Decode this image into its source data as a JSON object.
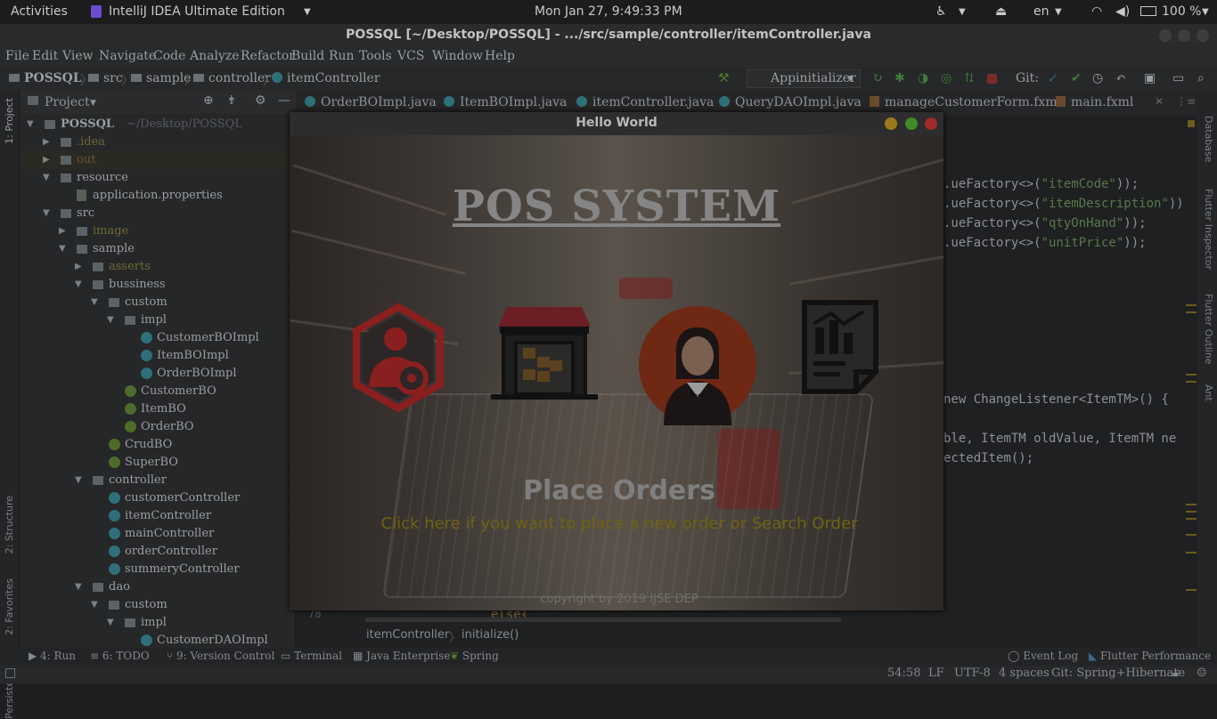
{
  "topbar": {
    "activities": "Activities",
    "app_name": "IntelliJ IDEA Ultimate Edition",
    "clock": "Mon Jan 27,  9:49:33 PM",
    "keyboard": "en",
    "battery": "100 %"
  },
  "ide": {
    "title": "POSSQL [~/Desktop/POSSQL] - .../src/sample/controller/itemController.java",
    "menu": [
      "File",
      "Edit",
      "View",
      "Navigate",
      "Code",
      "Analyze",
      "Refactor",
      "Build",
      "Run",
      "Tools",
      "VCS",
      "Window",
      "Help"
    ],
    "breadcrumb": [
      "POSSQL",
      "src",
      "sample",
      "controller",
      "itemController"
    ],
    "run_config": "Appinitializer",
    "git_label": "Git:",
    "project_label": "Project",
    "tabs": [
      "OrderBOImpl.java",
      "ItemBOImpl.java",
      "itemController.java",
      "QueryDAOImpl.java",
      "manageCustomerForm.fxml",
      "main.fxml"
    ],
    "tree": [
      {
        "label": "POSSQL",
        "extra": "~/Desktop/POSSQL"
      },
      {
        "label": ".idea"
      },
      {
        "label": "out"
      },
      {
        "label": "resource"
      },
      {
        "label": "application.properties"
      },
      {
        "label": "src"
      },
      {
        "label": "image"
      },
      {
        "label": "sample"
      },
      {
        "label": "asserts"
      },
      {
        "label": "bussiness"
      },
      {
        "label": "custom"
      },
      {
        "label": "impl"
      },
      {
        "label": "CustomerBOImpl"
      },
      {
        "label": "ItemBOImpl"
      },
      {
        "label": "OrderBOImpl"
      },
      {
        "label": "CustomerBO"
      },
      {
        "label": "ItemBO"
      },
      {
        "label": "OrderBO"
      },
      {
        "label": "CrudBO"
      },
      {
        "label": "SuperBO"
      },
      {
        "label": "controller"
      },
      {
        "label": "customerController"
      },
      {
        "label": "itemController"
      },
      {
        "label": "mainController"
      },
      {
        "label": "orderController"
      },
      {
        "label": "summeryController"
      },
      {
        "label": "dao"
      },
      {
        "label": "custom"
      },
      {
        "label": "impl"
      },
      {
        "label": "CustomerDAOImpl"
      }
    ],
    "code_lines": [
      {
        "pre": ".ueFactory<>(",
        "str": "\"itemCode\"",
        "post": "));"
      },
      {
        "pre": ".ueFactory<>(",
        "str": "\"itemDescription\"",
        "post": "))"
      },
      {
        "pre": ".ueFactory<>(",
        "str": "\"qtyOnHand\"",
        "post": "));"
      },
      {
        "pre": ".ueFactory<>(",
        "str": "\"unitPrice\"",
        "post": "));"
      }
    ],
    "code_line_listener": "new ChangeListener<ItemTM>() {",
    "code_line_args": "ble, ItemTM oldValue, ItemTM ne",
    "code_line_selected": "ectedItem();",
    "code_line_else": "else{",
    "line_number": "78",
    "editor_breadcrumb": [
      "itemController",
      "initialize()"
    ],
    "side_left": [
      "1: Project",
      "2: Structure",
      "2: Favorites",
      "Persistence"
    ],
    "side_right": [
      "Database",
      "Flutter Inspector",
      "Flutter Outline",
      "Ant"
    ],
    "bottom_tools": [
      "4: Run",
      "6: TODO",
      "9: Version Control",
      "Terminal",
      "Java Enterprise",
      "Spring",
      "Event Log",
      "Flutter Performance"
    ],
    "status": {
      "position": "54:58",
      "line_sep": "LF",
      "encoding": "UTF-8",
      "indent": "4 spaces",
      "git": "Git: Spring+Hibernate"
    }
  },
  "dialog": {
    "title": "Hello World",
    "heading": "POS SYSTEM",
    "place_title": "Place Orders",
    "place_sub": "Click here if you want to place a new order or Search Order",
    "copyright": "copyright by 2019 IJSE DEP",
    "cards": [
      "manage-customers",
      "manage-items",
      "place-orders",
      "reports"
    ]
  }
}
